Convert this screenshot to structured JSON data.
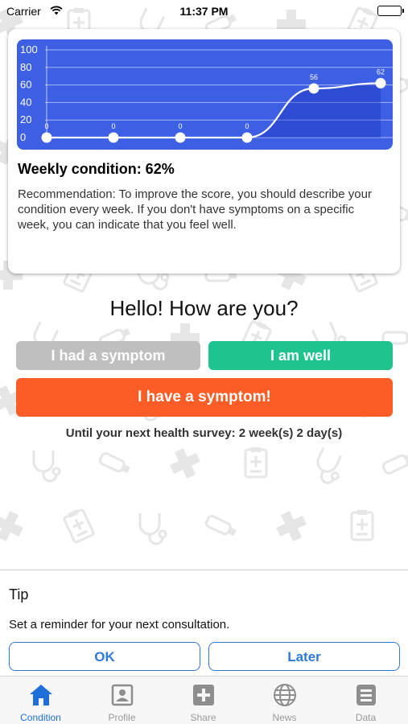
{
  "status_bar": {
    "carrier": "Carrier",
    "time": "11:37 PM"
  },
  "chart_card": {
    "condition_title": "Weekly condition: 62%",
    "recommendation": "Recommendation:  To improve the score, you should describe your condition every week. If you don't have symptoms on a specific week, you can indicate that you feel well."
  },
  "chart_data": {
    "type": "line",
    "x": [
      1,
      2,
      3,
      4,
      5,
      6
    ],
    "values": [
      0,
      0,
      0,
      0,
      56,
      62
    ],
    "point_labels": [
      "0",
      "0",
      "0",
      "0",
      "56",
      "62"
    ],
    "y_ticks": [
      "0",
      "20",
      "40",
      "60",
      "80",
      "100"
    ],
    "ylim": [
      0,
      100
    ],
    "grid": true,
    "curve": "smooth",
    "background_color": "#3d5fe4",
    "line_color": "#ffffff"
  },
  "greeting": "Hello! How are you?",
  "buttons": {
    "had_symptom": "I had a symptom",
    "am_well": "I am well",
    "have_symptom": "I have a symptom!"
  },
  "survey_text": "Until your next health survey:  2 week(s) 2 day(s)",
  "tip": {
    "title": "Tip",
    "text": "Set a reminder for your next consultation.",
    "ok_label": "OK",
    "later_label": "Later"
  },
  "tab_bar": {
    "tabs": [
      {
        "label": "Condition",
        "icon": "home-icon",
        "active": true
      },
      {
        "label": "Profile",
        "icon": "profile-icon",
        "active": false
      },
      {
        "label": "Share",
        "icon": "share-plus-icon",
        "active": false
      },
      {
        "label": "News",
        "icon": "globe-icon",
        "active": false
      },
      {
        "label": "Data",
        "icon": "data-icon",
        "active": false
      }
    ]
  },
  "colors": {
    "accent_blue": "#1f6fd9",
    "chart_blue": "#3d5fe4",
    "well_green": "#1ec38e",
    "symptom_orange": "#fc5c25",
    "had_gray": "#bfbfbf",
    "pattern_gray": "#e6e6e6"
  }
}
